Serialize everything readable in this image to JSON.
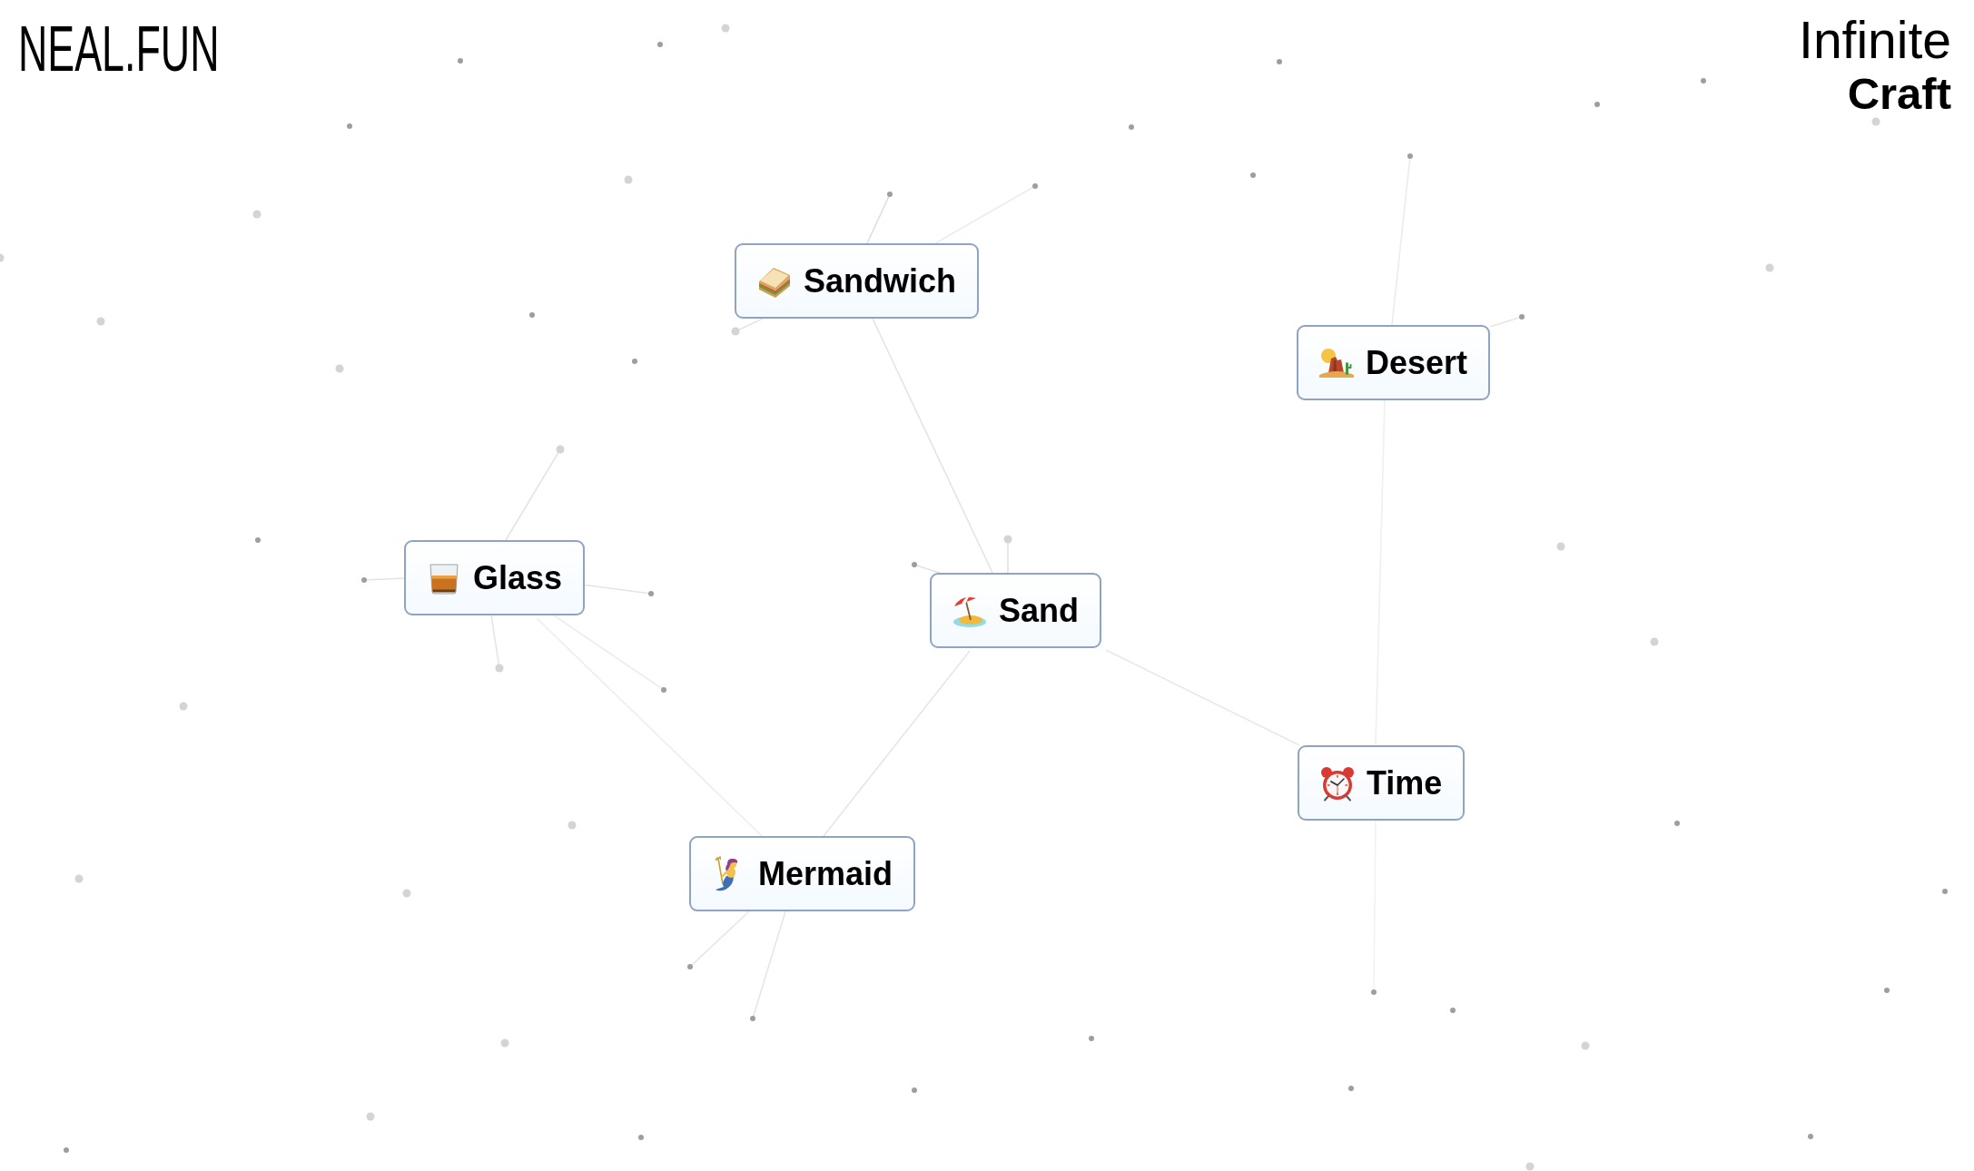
{
  "header": {
    "site_logo": "NEAL.FUN",
    "app_logo": {
      "line_1": "Infinite",
      "line_2": "Craft"
    }
  },
  "canvas": {
    "items": [
      {
        "label": "Sandwich",
        "kind": "sandwich"
      },
      {
        "label": "Desert",
        "kind": "desert"
      },
      {
        "label": "Glass",
        "kind": "glass"
      },
      {
        "label": "Sand",
        "kind": "beach"
      },
      {
        "label": "Time",
        "kind": "clock"
      },
      {
        "label": "Mermaid",
        "kind": "mermaid"
      }
    ]
  }
}
